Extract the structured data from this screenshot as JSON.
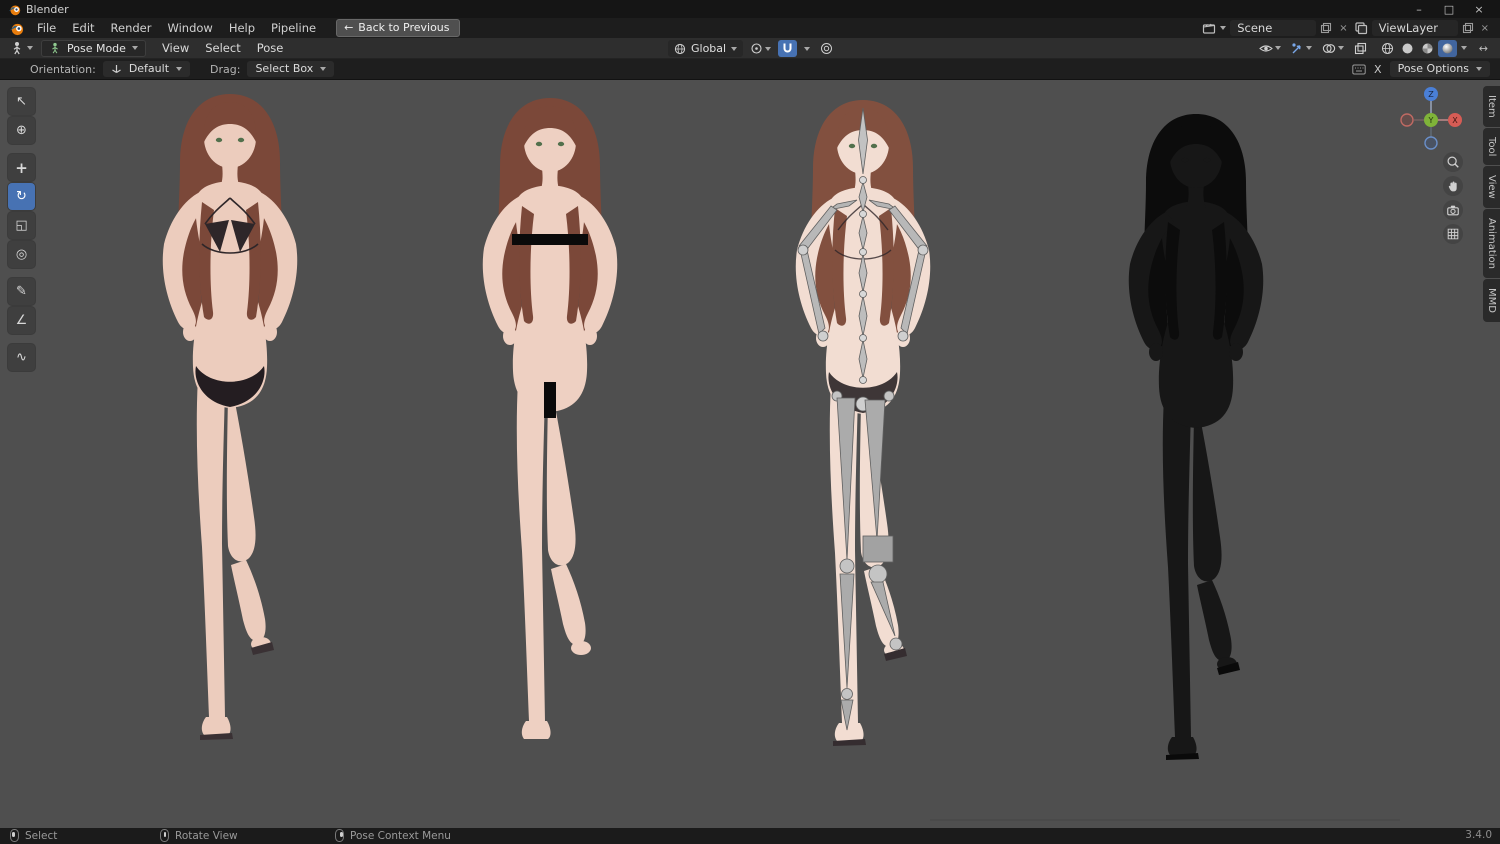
{
  "window": {
    "title": "Blender"
  },
  "icons": {
    "minimize": "–",
    "maximize": "□",
    "close": "×",
    "back_arrow": "←",
    "unlink": "×",
    "expand": "↔"
  },
  "menubar": {
    "menus": [
      "File",
      "Edit",
      "Render",
      "Window",
      "Help",
      "Pipeline"
    ],
    "back_button": "Back to Previous",
    "scene": {
      "label": "Scene"
    },
    "viewlayer": {
      "label": "ViewLayer"
    }
  },
  "tool_header": {
    "mode": "Pose Mode",
    "menus": [
      "View",
      "Select",
      "Pose"
    ],
    "orientation": "Global"
  },
  "options_bar": {
    "orientation_label": "Orientation:",
    "orientation_value": "Default",
    "drag_label": "Drag:",
    "drag_value": "Select Box",
    "clear_shortcut": "X",
    "pose_options": "Pose Options"
  },
  "left_toolbar": {
    "tools": [
      {
        "name": "tweak-select",
        "glyph": "↖"
      },
      {
        "name": "cursor",
        "glyph": "⊕"
      },
      {
        "name": "move",
        "glyph": "+"
      },
      {
        "name": "rotate",
        "glyph": "↻"
      },
      {
        "name": "scale",
        "glyph": "◱"
      },
      {
        "name": "transform",
        "glyph": "◎"
      },
      {
        "name": "annotate",
        "glyph": "✎"
      },
      {
        "name": "measure",
        "glyph": "∠"
      },
      {
        "name": "pose-breakdowner",
        "glyph": "∿"
      }
    ]
  },
  "gizmo": {
    "x": "X",
    "y": "Y",
    "z": "Z"
  },
  "sidebar_tabs": [
    "Item",
    "Tool",
    "View",
    "Animation",
    "MMD"
  ],
  "status_bar": {
    "hints": [
      "Select",
      "Rotate View",
      "Pose Context Menu"
    ],
    "version": "3.4.0"
  },
  "colors": {
    "accent": "#4772b3",
    "viewport_bg": "#4f4f4f",
    "header_bg": "#2e2e2e",
    "bar_bg": "#1d1d1d"
  }
}
